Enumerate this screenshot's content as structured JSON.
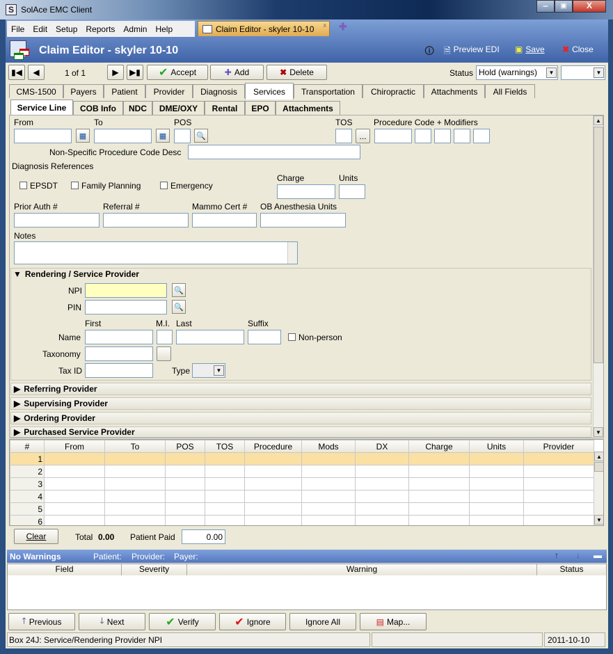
{
  "window": {
    "title": "SolAce EMC Client",
    "app_icon": "S"
  },
  "menu": [
    "File",
    "Edit",
    "Setup",
    "Reports",
    "Admin",
    "Help"
  ],
  "doc_tab": {
    "label": "Claim Editor - skyler 10-10",
    "close": "x"
  },
  "header": {
    "title": "Claim Editor - skyler 10-10",
    "preview": "Preview EDI",
    "save": "Save",
    "close": "Close"
  },
  "toolbar": {
    "record": "1 of 1",
    "accept": "Accept",
    "add": "Add",
    "delete": "Delete",
    "status_label": "Status",
    "status_value": "Hold (warnings)",
    "status2_value": ""
  },
  "tabs": [
    "CMS-1500",
    "Payers",
    "Patient",
    "Provider",
    "Diagnosis",
    "Services",
    "Transportation",
    "Chiropractic",
    "Attachments",
    "All Fields"
  ],
  "active_tab": "Services",
  "subtabs": [
    "Service Line",
    "COB Info",
    "NDC",
    "DME/OXY",
    "Rental",
    "EPO",
    "Attachments"
  ],
  "form": {
    "from": "From",
    "to": "To",
    "pos": "POS",
    "tos": "TOS",
    "tos_btn": "...",
    "proc": "Procedure Code + Modifiers",
    "nonspec": "Non-Specific Procedure Code Desc",
    "diag_refs": "Diagnosis References",
    "epsdt": "EPSDT",
    "family": "Family Planning",
    "emergency": "Emergency",
    "charge": "Charge",
    "units": "Units",
    "prior_auth": "Prior Auth #",
    "referral": "Referral #",
    "mammo": "Mammo Cert #",
    "ob": "OB Anesthesia Units",
    "notes": "Notes"
  },
  "rendering": {
    "title": "Rendering / Service Provider",
    "npi": "NPI",
    "pin": "PIN",
    "first": "First",
    "mi": "M.I.",
    "last": "Last",
    "suffix": "Suffix",
    "name": "Name",
    "nonperson": "Non-person",
    "taxonomy": "Taxonomy",
    "taxid": "Tax ID",
    "type": "Type"
  },
  "sections": [
    "Referring Provider",
    "Supervising Provider",
    "Ordering Provider",
    "Purchased Service Provider"
  ],
  "grid": {
    "columns": [
      "#",
      "From",
      "To",
      "POS",
      "TOS",
      "Procedure",
      "Mods",
      "DX",
      "Charge",
      "Units",
      "Provider"
    ],
    "rows": [
      "1",
      "2",
      "3",
      "4",
      "5",
      "6"
    ]
  },
  "totals": {
    "clear": "Clear",
    "total_label": "Total",
    "total": "0.00",
    "paid_label": "Patient Paid",
    "paid": "0.00"
  },
  "warnings": {
    "title": "No Warnings",
    "patient": "Patient:",
    "provider": "Provider:",
    "payer": "Payer:",
    "columns": [
      "Field",
      "Severity",
      "Warning",
      "Status"
    ]
  },
  "bottom_buttons": {
    "previous": "Previous",
    "next": "Next",
    "verify": "Verify",
    "ignore": "Ignore",
    "ignore_all": "Ignore All",
    "map": "Map..."
  },
  "statusbar": {
    "message": "Box 24J: Service/Rendering Provider NPI",
    "middle": "",
    "date": "2011-10-10"
  }
}
